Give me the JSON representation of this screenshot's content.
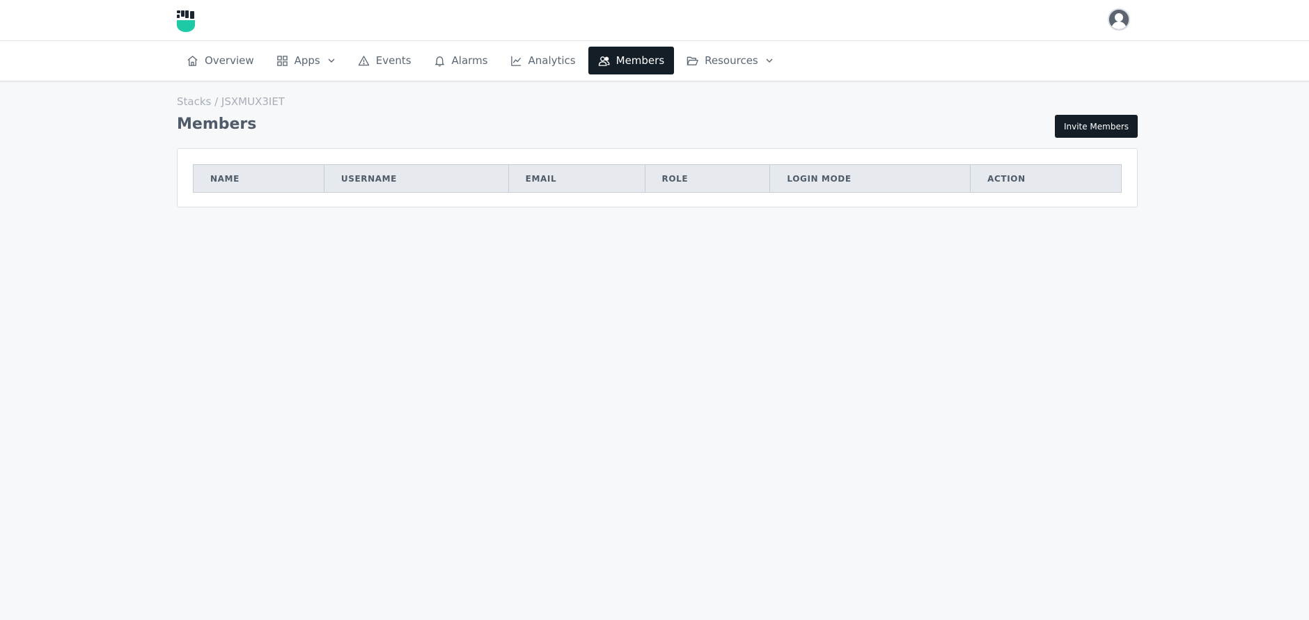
{
  "header": {
    "logo_icon": "fist-shield-logo",
    "avatar_icon": "user-avatar-icon",
    "brand_color": "#1ec9a6"
  },
  "nav": {
    "items": [
      {
        "label": "Overview",
        "icon": "home-icon"
      },
      {
        "label": "Apps",
        "icon": "grid-icon",
        "has_dropdown": true
      },
      {
        "label": "Events",
        "icon": "warning-triangle-icon"
      },
      {
        "label": "Alarms",
        "icon": "bell-icon"
      },
      {
        "label": "Analytics",
        "icon": "line-chart-icon"
      },
      {
        "label": "Members",
        "icon": "users-icon",
        "active": true
      },
      {
        "label": "Resources",
        "icon": "folder-open-icon",
        "has_dropdown": true
      }
    ],
    "active_color": "#131e26"
  },
  "breadcrumb": "Stacks / JSXMUX3IET",
  "page": {
    "title": "Members",
    "invite_button_label": "Invite Members"
  },
  "members_table": {
    "columns": [
      "NAME",
      "USERNAME",
      "EMAIL",
      "ROLE",
      "LOGIN MODE",
      "ACTION"
    ],
    "rows": []
  }
}
